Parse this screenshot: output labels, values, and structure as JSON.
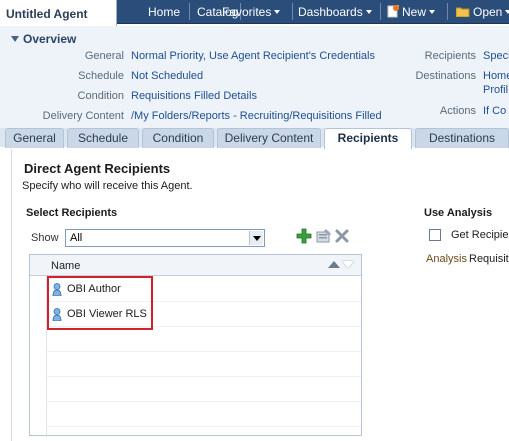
{
  "app": {
    "title": "Untitled Agent"
  },
  "nav": {
    "home": "Home",
    "catalog": "Catalog",
    "favorites": "Favorites",
    "dashboards": "Dashboards",
    "new": "New",
    "open": "Open"
  },
  "overview": {
    "title": "Overview",
    "general_label": "General",
    "general_value": "Normal Priority, Use Agent Recipient's Credentials",
    "schedule_label": "Schedule",
    "schedule_value": "Not Scheduled",
    "condition_label": "Condition",
    "condition_value": "Requisitions Filled Details",
    "delivery_label": "Delivery Content",
    "delivery_value": "/My Folders/Reports - Recruiting/Requisitions Filled",
    "recipients_label": "Recipients",
    "recipients_value": "Speci",
    "destinations_label": "Destinations",
    "destinations_value_1": "Home",
    "destinations_value_2": "Profil",
    "actions_label": "Actions",
    "actions_value": "If Co"
  },
  "tabs": [
    {
      "label": "General"
    },
    {
      "label": "Schedule"
    },
    {
      "label": "Condition"
    },
    {
      "label": "Delivery Content"
    },
    {
      "label": "Recipients",
      "active": true
    },
    {
      "label": "Destinations"
    }
  ],
  "recipients": {
    "heading": "Direct Agent Recipients",
    "description": "Specify who will receive this Agent.",
    "select_heading": "Select Recipients",
    "show_label": "Show",
    "show_value": "All",
    "column_name": "Name",
    "rows": [
      {
        "name": "OBI Author"
      },
      {
        "name": "OBI Viewer RLS"
      }
    ]
  },
  "use_analysis": {
    "heading": "Use Analysis",
    "checkbox_label": "Get Recipien",
    "checked": false,
    "analysis_label": "Analysis",
    "analysis_value": "Requisiti"
  },
  "colors": {
    "highlight_box": "#d4202a",
    "topbar": "#2a4d7a",
    "link": "#1d4f91"
  }
}
